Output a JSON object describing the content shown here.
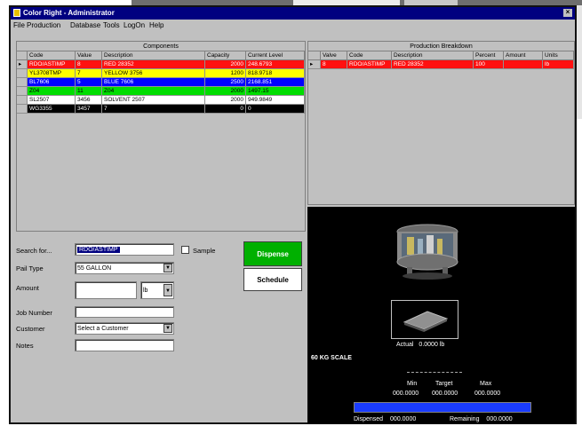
{
  "window": {
    "title": "Color Right - Administrator",
    "close_glyph": "×"
  },
  "menu": [
    "File",
    "Production",
    "Database",
    "Tools",
    "LogOn",
    "Help"
  ],
  "components": {
    "title": "Components",
    "columns": [
      "Code",
      "Value",
      "Description",
      "Capacity",
      "Current Level"
    ],
    "rows": [
      {
        "code": "RDO/ASTIMP",
        "value": "8",
        "desc": "RED 28352",
        "capacity": "2000",
        "level": "248.6793",
        "bg": "#ff1010",
        "fg": "#ffffff",
        "marker": "▸"
      },
      {
        "code": "YL3708TMP",
        "value": "7",
        "desc": "YELLOW 3756",
        "capacity": "1200",
        "level": "818.9718",
        "bg": "#ffff00",
        "fg": "#000000",
        "marker": ""
      },
      {
        "code": "BL7606",
        "value": "5",
        "desc": "BLUE 7606",
        "capacity": "2500",
        "level": "2168.851",
        "bg": "#0000ff",
        "fg": "#ffffff",
        "marker": ""
      },
      {
        "code": "Z04",
        "value": "11",
        "desc": "Z04",
        "capacity": "2000",
        "level": "1497.15",
        "bg": "#00dd00",
        "fg": "#000000",
        "marker": ""
      },
      {
        "code": "SL2507",
        "value": "3456",
        "desc": "SOLVENT 2507",
        "capacity": "2000",
        "level": "949.9849",
        "bg": "#ffffff",
        "fg": "#000000",
        "marker": ""
      },
      {
        "code": "WG3355",
        "value": "3457",
        "desc": "7",
        "capacity": "0",
        "level": "0",
        "bg": "#000000",
        "fg": "#ffffff",
        "marker": ""
      }
    ]
  },
  "production": {
    "title": "Production Breakdown",
    "columns": [
      "Valve",
      "Code",
      "Description",
      "Percent",
      "Amount",
      "Units"
    ],
    "rows": [
      {
        "valve": "8",
        "code": "RDO/ASTIMP",
        "desc": "RED 28352",
        "percent": "100",
        "amount": "",
        "units": "lb",
        "bg": "#ff1010",
        "fg": "#ffffff",
        "marker": "▸"
      }
    ]
  },
  "form": {
    "search_label": "Search for...",
    "search_value": "RDO/ASTIMP",
    "sample_label": "Sample",
    "pail_label": "Pail Type",
    "pail_value": "55 GALLON",
    "amount_label": "Amount",
    "amount_value": "",
    "unit_value": "lb",
    "job_label": "Job Number",
    "job_value": "",
    "customer_label": "Customer",
    "customer_value": "Select a Customer",
    "notes_label": "Notes",
    "notes_value": ""
  },
  "buttons": {
    "dispense": "Dispense",
    "schedule": "Schedule"
  },
  "scale": {
    "actual_label": "Actual",
    "actual_value": "0.0000 lb",
    "scale_name": "60 KG SCALE",
    "min_label": "Min",
    "target_label": "Target",
    "max_label": "Max",
    "min_value": "000.0000",
    "target_value": "000.0000",
    "max_value": "000.0000",
    "dispensed_label": "Dispensed",
    "dispensed_value": "000.0000",
    "remaining_label": "Remaining",
    "remaining_value": "000.0000",
    "progress": 1.0
  },
  "colors": {
    "title_bar": "#000080",
    "dispense": "#00b000",
    "progress": "#1a3cff"
  }
}
